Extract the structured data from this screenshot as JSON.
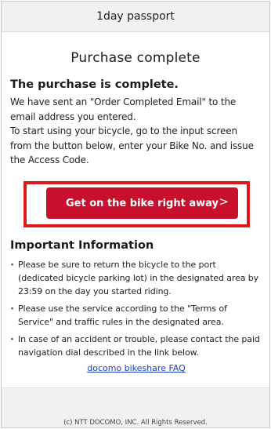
{
  "header": {
    "title": "1day passport"
  },
  "page": {
    "title": "Purchase complete"
  },
  "confirmation": {
    "heading": "The purchase is complete.",
    "message_1": "We have sent an \"Order Completed Email\" to the email address you entered.",
    "message_2": "To start using your bicycle, go to the input screen from the button below, enter your Bike No. and issue the Access Code."
  },
  "cta": {
    "label": "Get on the bike right away",
    "chevron": ">"
  },
  "info": {
    "heading": "Important Information",
    "items": [
      "Please be sure to return the bicycle to the port (dedicated bicycle parking lot) in the designated area by 23:59 on the day you started riding.",
      "Please use the service according to the \"Terms of Service\" and traffic rules in the designated area.",
      "In case of an accident or trouble, please contact the paid navigation dial described in the link below."
    ],
    "faq_link": "docomo bikeshare FAQ"
  },
  "footer": {
    "copyright": "(c) NTT DOCOMO, INC. All Rights Reserved."
  },
  "colors": {
    "accent": "#c8102e",
    "highlight": "#e01818",
    "link": "#1a3ccf"
  },
  "icons": {
    "cta_chevron": "chevron-right-icon"
  }
}
